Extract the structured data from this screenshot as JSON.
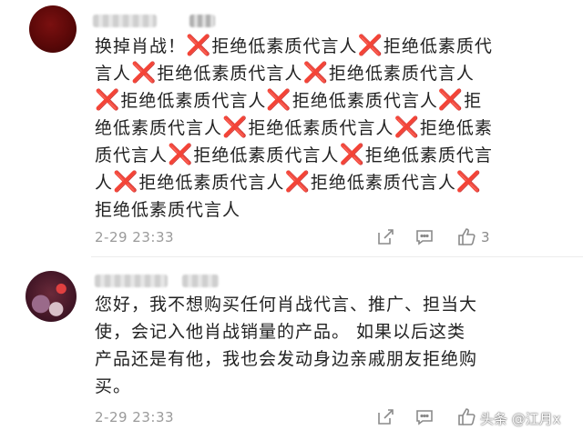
{
  "comments": [
    {
      "text_prefix": "换掉肖战！",
      "repeat_unit": "拒绝低素质代言人",
      "repeat_count": 14,
      "time": "2-29 23:33",
      "likes": "3"
    },
    {
      "text": "您好，我不想购买任何肖战代言、推广、担当大使，会记入他肖战销量的产品。 如果以后这类产品还是有他，我也会发动身边亲戚朋友拒绝购买。",
      "time": "2-29 23:33",
      "likes": ""
    }
  ],
  "watermark": "头条 @江月x",
  "colors": {
    "accent_x": "#d40000",
    "meta": "#9a9a9a"
  },
  "icons": [
    "share-icon",
    "comment-icon",
    "like-icon"
  ]
}
